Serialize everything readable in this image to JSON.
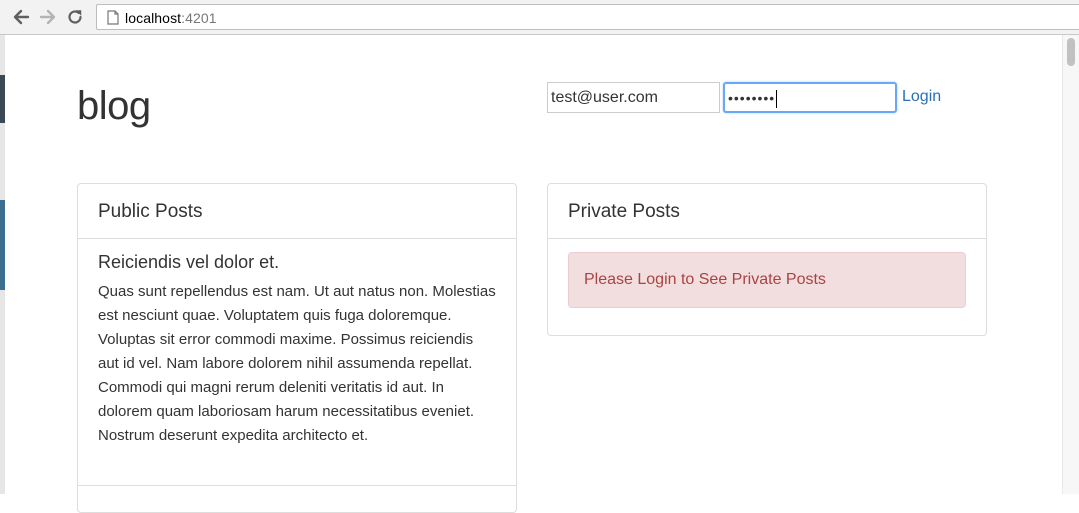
{
  "browser": {
    "url_host": "localhost",
    "url_port": ":4201"
  },
  "app": {
    "brand": "blog"
  },
  "login": {
    "email_value": "test@user.com",
    "password_mask": "••••••••",
    "login_label": "Login"
  },
  "public_panel": {
    "title": "Public Posts",
    "posts": [
      {
        "title": "Reiciendis vel dolor et.",
        "body": "Quas sunt repellendus est nam. Ut aut natus non. Molestias est nesciunt quae. Voluptatem quis fuga doloremque. Voluptas sit error commodi maxime. Possimus reiciendis aut id vel. Nam labore dolorem nihil assumenda repellat. Commodi qui magni rerum deleniti veritatis id aut. In dolorem quam laboriosam harum necessitatibus eveniet. Nostrum deserunt expedita architecto et."
      }
    ]
  },
  "private_panel": {
    "title": "Private Posts",
    "alert": "Please Login to See Private Posts"
  },
  "colors": {
    "link": "#2a6fb6",
    "alert_bg": "#f2dede",
    "alert_text": "#a94442",
    "focus_ring": "#6aa8f5"
  }
}
